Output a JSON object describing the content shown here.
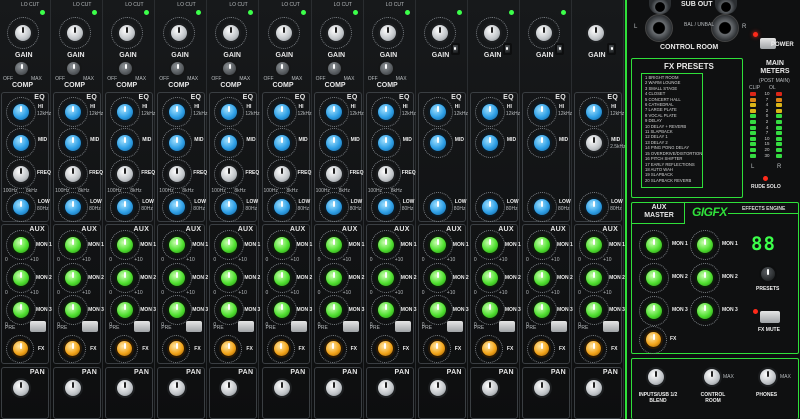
{
  "channel_strip": {
    "top_labels": [
      "LO CUT",
      "LO CUT",
      "LO CUT",
      "LO CUT",
      "LO CUT",
      "LO CUT",
      "LO CUT",
      "LO CUT"
    ],
    "gain_label": "GAIN",
    "comp_label": "COMP",
    "comp_off": "OFF",
    "comp_max": "MAX",
    "eq_label": "EQ",
    "hi_label": "HI",
    "hi_freq": "12kHz",
    "mid_label": "MID",
    "freq_label": "FREQ",
    "freq_low": "100Hz",
    "freq_high": "8kHz",
    "low_label": "LOW",
    "low_freq": "80Hz",
    "aux_label": "AUX",
    "mon1_label": "MON 1",
    "mon2_label": "MON 2",
    "mon3_label": "MON 3",
    "fx_label": "FX",
    "pan_label": "PAN",
    "knob_min": "0",
    "knob_max": "+10",
    "pre_label": "PRE"
  },
  "stereo_channel": {
    "mid_label": "MID",
    "mid_freq": "2.5kHz"
  },
  "master": {
    "sub_out_label": "SUB OUT",
    "control_room_label": "CONTROL ROOM",
    "cr_left": "L",
    "cr_right": "R",
    "cr_jack_note": "BAL / UNBAL",
    "power_label": "POWER",
    "fx_presets_title": "FX PRESETS",
    "fx_presets": [
      "1 BRIGHT ROOM",
      "2 WARM LOUNGE",
      "3 SMALL STAGE",
      "4 CLOSET",
      "5 CONCERT HALL",
      "6 CATHEDRAL",
      "7 LARGE PLATE",
      "8 VOCAL PLATE",
      "9 DELAY",
      "10 DELAY + REVERB",
      "11 SLAPBACK",
      "12 DELAY 1",
      "13 DELAY 2",
      "14 PING PONG DELAY",
      "15 OVERDRIVE/DISTORTION",
      "16 PITCH SHIFTER",
      "17 EARLY REFLECTIONS",
      "18 AUTO WAH",
      "19 SLAPBACK",
      "20 SLAPBACK REVERB"
    ],
    "main_meters_title": "MAIN METERS",
    "main_meters_sub": "(POST MAIN)",
    "meter_top": [
      "CLIP",
      "OL"
    ],
    "meter_scale": [
      "10",
      "7",
      "4",
      "2",
      "0",
      "2",
      "4",
      "7",
      "10",
      "15",
      "20",
      "30"
    ],
    "meter_l": "L",
    "meter_r": "R",
    "rude_solo_label": "RUDE SOLO",
    "aux_master_title": "AUX MASTER",
    "gigfx_logo": "GIGFX",
    "effects_engine_label": "EFFECTS ENGINE",
    "aux_mon1": "MON 1",
    "aux_mon2": "MON 2",
    "aux_mon3": "MON 3",
    "aux_fx": "FX",
    "preset_display": "88",
    "presets_label": "PRESETS",
    "fx_mute_label": "FX MUTE",
    "blend_label": "INPUTS/USB 1/2 BLEND",
    "control_room_knob_label": "CONTROL ROOM",
    "phones_label": "PHONES",
    "max_label": "MAX"
  },
  "colors": {
    "accent_green": "#2fe03a",
    "knob_blue": "#2e9fe6",
    "knob_green": "#4fe02f",
    "knob_yellow": "#f3a51a",
    "knob_white": "#f0f0f0",
    "led_red": "#ff2a1a",
    "display_green": "#3cff4a"
  }
}
